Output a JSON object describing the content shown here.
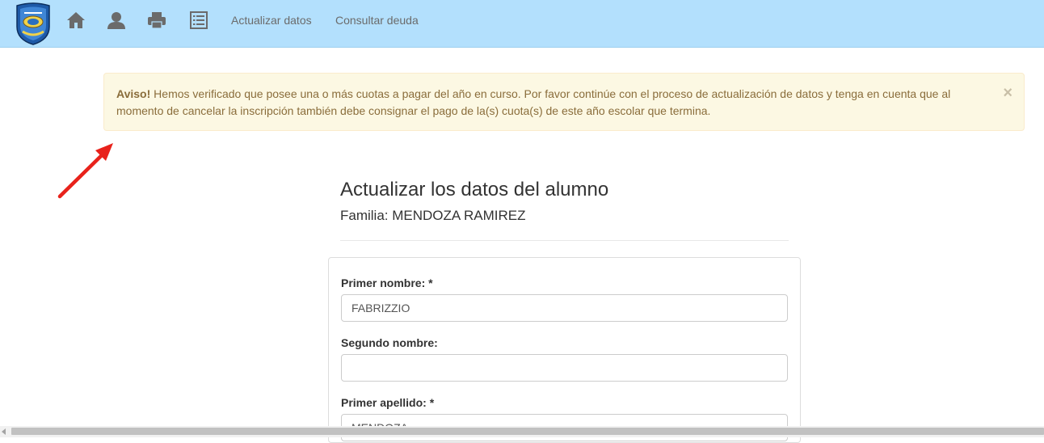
{
  "navbar": {
    "links": [
      {
        "label": "Actualizar datos"
      },
      {
        "label": "Consultar deuda"
      }
    ],
    "icons": [
      "home-icon",
      "user-icon",
      "print-icon",
      "list-icon"
    ]
  },
  "alert": {
    "strong": "Aviso!",
    "message": " Hemos verificado que posee una o más cuotas a pagar del año en curso. Por favor continúe con el proceso de actualización de datos y tenga en cuenta que al momento de cancelar la inscripción también debe consignar el pago de la(s) cuota(s) de este año escolar que termina.",
    "close": "×"
  },
  "form": {
    "title": "Actualizar los datos del alumno",
    "subtitle": "Familia: MENDOZA RAMIREZ",
    "fields": [
      {
        "label": "Primer nombre: *",
        "value": "FABRIZZIO"
      },
      {
        "label": "Segundo nombre:",
        "value": ""
      },
      {
        "label": "Primer apellido: *",
        "value": "MENDOZA"
      }
    ]
  },
  "colors": {
    "navbar": "#b3e0fd",
    "alert_bg": "#fcf8e3",
    "alert_text": "#8a6d3b",
    "arrow": "#e8221b"
  }
}
